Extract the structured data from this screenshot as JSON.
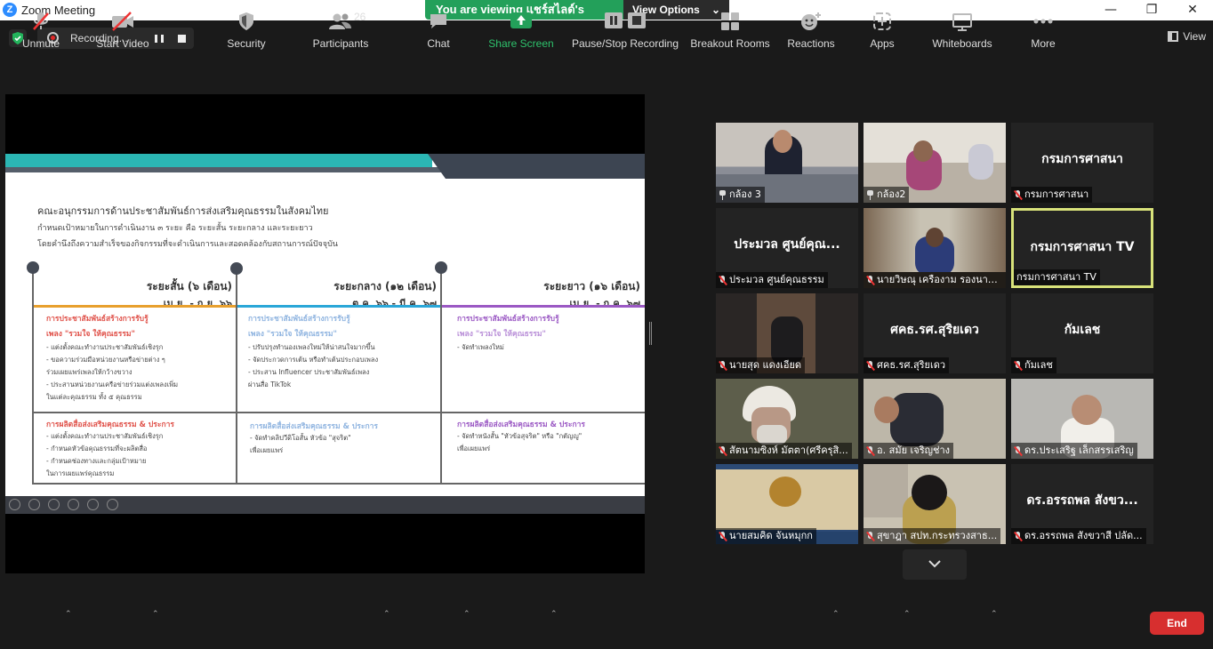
{
  "window": {
    "title": "Zoom Meeting",
    "logo_letter": "Z"
  },
  "banner": {
    "viewing_text": "You are viewing แชร์สไลด์'s screen",
    "view_options": "View Options"
  },
  "recording": {
    "label": "Recording..."
  },
  "view_button": {
    "label": "View"
  },
  "slide": {
    "heading": "คณะอนุกรรมการด้านประชาสัมพันธ์การส่งเสริมคุณธรรมในสังคมไทย",
    "line1": "กำหนดเป้าหมายในการดำเนินงาน ๓ ระยะ คือ ระยะสั้น ระยะกลาง และระยะยาว",
    "line2": "โดยคำนึงถึงความสำเร็จของกิจกรรมที่จะดำเนินการและสอดคล้องกับสถานการณ์ปัจจุบัน",
    "phases": [
      {
        "title": "ระยะสั้น (๖ เดือน)",
        "period": "เม.ย. - ก.ย. ๖๖",
        "color": "#e8a02e",
        "sec1_title": "การประชาสัมพันธ์สร้างการรับรู้",
        "sec1_sub": "เพลง \"รวมใจ ให้คุณธรรม\"",
        "sec1_bullets": [
          "- แต่งตั้งคณะทำงานประชาสัมพันธ์เชิงรุก",
          "- ขอความร่วมมือหน่วยงานหรือข่ายต่าง ๆ",
          "ร่วมเผยแพร่เพลงให้กว้างขวาง",
          "- ประสานหน่วยงานเครือข่ายร่วมแต่งเพลงเพิ่ม",
          "ในแต่ละคุณธรรม ทั้ง ๕ คุณธรรม"
        ],
        "sec2_title": "การผลิตสื่อส่งเสริมคุณธรรม & ประการ",
        "sec2_bullets": [
          "- แต่งตั้งคณะทำงานประชาสัมพันธ์เชิงรุก",
          "- กำหนดหัวข้อคุณธรรมที่จะผลิตสื่อ",
          "- กำหนดช่องทางและกลุ่มเป้าหมาย",
          "ในการเผยแพร่คุณธรรม"
        ]
      },
      {
        "title": "ระยะกลาง (๑๒ เดือน)",
        "period": "ต.ค. ๖๖ - มี.ค. ๖๗",
        "color": "#2aa7d8",
        "sec1_title": "การประชาสัมพันธ์สร้างการรับรู้",
        "sec1_sub": "เพลง \"รวมใจ ให้คุณธรรม\"",
        "sec1_bullets": [
          "- ปรับปรุงทำนองเพลงใหม่ให้น่าสนใจมากขึ้น",
          "- จัดประกวดการเต้น หรือทำเต้นประกอบเพลง",
          "- ประสาน Influencer ประชาสัมพันธ์เพลง",
          "ผ่านสื่อ TikTok"
        ],
        "sec2_title": "การผลิตสื่อส่งเสริมคุณธรรม & ประการ",
        "sec2_bullets": [
          "- จัดทำคลิปวีดิโอสั้น หัวข้อ \"สุจริต\"",
          "เพื่อเผยแพร่"
        ]
      },
      {
        "title": "ระยะยาว (๑๖ เดือน)",
        "period": "เม.ย. - ก.ค. ๖๗",
        "color": "#9b59c4",
        "sec1_title": "การประชาสัมพันธ์สร้างการรับรู้",
        "sec1_sub": "เพลง \"รวมใจ ให้คุณธรรม\"",
        "sec1_bullets": [
          "- จัดทำเพลงใหม่"
        ],
        "sec2_title": "การผลิตสื่อส่งเสริมคุณธรรม & ประการ",
        "sec2_bullets": [
          "- จัดทำหนังสั้น \"หัวข้อสุจริต\" หรือ \"กตัญญู\"",
          "เพื่อเผยแพร่"
        ]
      }
    ]
  },
  "participants_grid": [
    {
      "name": "กล้อง 3",
      "big": "",
      "video": true,
      "icon": "pin"
    },
    {
      "name": "กล้อง2",
      "big": "",
      "video": true,
      "icon": "pin"
    },
    {
      "name": "กรมการศาสนา",
      "big": "กรมการศาสนา",
      "video": false,
      "icon": "mic-muted"
    },
    {
      "name": "ประมวล ศูนย์คุณธรรม",
      "big": "ประมวล ศูนย์คุณ...",
      "video": false,
      "icon": "mic-muted"
    },
    {
      "name": "นายวิษณุ เครืองาม รองนายก...",
      "big": "",
      "video": true,
      "icon": "mic-muted"
    },
    {
      "name": "กรมการศาสนา TV",
      "big": "กรมการศาสนา TV",
      "video": false,
      "icon": "none",
      "active": true
    },
    {
      "name": "นายสุด แดงเอียด",
      "big": "",
      "video": true,
      "icon": "mic-muted"
    },
    {
      "name": "ศคธ.รศ.สุริยเดว",
      "big": "ศคธ.รศ.สุริยเดว",
      "video": false,
      "icon": "mic-muted"
    },
    {
      "name": "กัมเลช",
      "big": "กัมเลช",
      "video": false,
      "icon": "mic-muted"
    },
    {
      "name": "สัตนามซิงห์ มัตตา(ศรีครุสิ...",
      "big": "",
      "video": true,
      "icon": "mic-muted"
    },
    {
      "name": "อ. สมัย เจริญช่าง",
      "big": "",
      "video": true,
      "icon": "mic-muted"
    },
    {
      "name": "ดร.ประเสริฐ เล็กสรรเสริญ",
      "big": "",
      "video": true,
      "icon": "mic-muted"
    },
    {
      "name": "นายสมคิด จันหมุกก",
      "big": "",
      "video": true,
      "icon": "mic-muted"
    },
    {
      "name": "สุขาฎา สปท.กระทรวงสาธ...",
      "big": "",
      "video": true,
      "icon": "mic-muted"
    },
    {
      "name": "ดร.อรรถพล สังขวาสี ปลัด...",
      "big": "ดร.อรรถพล สังขว...",
      "video": false,
      "icon": "mic-muted"
    }
  ],
  "toolbar": {
    "unmute": "Unmute",
    "start_video": "Start Video",
    "security": "Security",
    "participants": "Participants",
    "participants_count": "26",
    "chat": "Chat",
    "share_screen": "Share Screen",
    "pause_stop": "Pause/Stop Recording",
    "breakout": "Breakout Rooms",
    "reactions": "Reactions",
    "apps": "Apps",
    "whiteboards": "Whiteboards",
    "more": "More",
    "end": "End"
  },
  "colors": {
    "share_green": "#23a05a",
    "end_red": "#d72f2f",
    "active_border": "#d8e27a",
    "teal": "#2bb6b4"
  }
}
